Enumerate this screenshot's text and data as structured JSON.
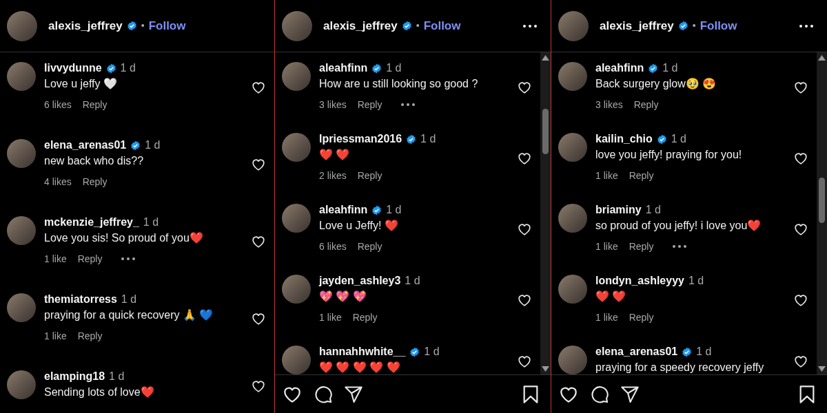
{
  "panels": [
    {
      "header": {
        "username": "alexis_jeffrey",
        "verified": true,
        "separator": "•",
        "follow": "Follow",
        "menu": false
      },
      "scrollbar": false,
      "action_bar": false,
      "comments": [
        {
          "username": "livvydunne",
          "verified": true,
          "time": "1 d",
          "text": "Love u jeffy 🤍",
          "likes": "6 likes",
          "reply": "Reply",
          "options": false,
          "liked": false
        },
        {
          "username": "elena_arenas01",
          "verified": true,
          "time": "1 d",
          "text": "new back who dis??",
          "likes": "4 likes",
          "reply": "Reply",
          "options": false,
          "liked": false
        },
        {
          "username": "mckenzie_jeffrey_",
          "verified": false,
          "time": "1 d",
          "text": "Love you sis! So proud of you❤️",
          "likes": "1 like",
          "reply": "Reply",
          "options": true,
          "liked": false
        },
        {
          "username": "themiatorress",
          "verified": false,
          "time": "1 d",
          "text": "praying for a quick recovery 🙏 💙",
          "likes": "1 like",
          "reply": "Reply",
          "options": false,
          "liked": false
        },
        {
          "username": "elamping18",
          "verified": false,
          "time": "1 d",
          "text": "Sending lots of love❤️",
          "options": false,
          "liked": false
        }
      ]
    },
    {
      "header": {
        "username": "alexis_jeffrey",
        "verified": true,
        "separator": "•",
        "follow": "Follow",
        "menu": true
      },
      "scrollbar": true,
      "action_bar": true,
      "comments": [
        {
          "username": "aleahfinn",
          "verified": true,
          "time": "1 d",
          "text": "How are u still looking so good ?",
          "likes": "3 likes",
          "reply": "Reply",
          "options": true,
          "liked": false
        },
        {
          "username": "lpriessman2016",
          "verified": true,
          "time": "1 d",
          "text": "❤️ ❤️",
          "likes": "2 likes",
          "reply": "Reply",
          "options": false,
          "liked": false
        },
        {
          "username": "aleahfinn",
          "verified": true,
          "time": "1 d",
          "text": "Love u Jeffy! ❤️",
          "likes": "6 likes",
          "reply": "Reply",
          "options": false,
          "liked": false
        },
        {
          "username": "jayden_ashley3",
          "verified": false,
          "time": "1 d",
          "text": "💖 💖 💖",
          "likes": "1 like",
          "reply": "Reply",
          "options": false,
          "liked": false
        },
        {
          "username": "hannahhwhite__",
          "verified": true,
          "time": "1 d",
          "text": "❤️ ❤️ ❤️ ❤️ ❤️",
          "options": false,
          "liked": false
        }
      ]
    },
    {
      "header": {
        "username": "alexis_jeffrey",
        "verified": true,
        "separator": "•",
        "follow": "Follow",
        "menu": true
      },
      "scrollbar": true,
      "action_bar": true,
      "comments": [
        {
          "username": "aleahfinn",
          "verified": true,
          "time": "1 d",
          "text": "Back surgery glow🥹 😍",
          "likes": "3 likes",
          "reply": "Reply",
          "options": false,
          "liked": false
        },
        {
          "username": "kailin_chio",
          "verified": true,
          "time": "1 d",
          "text": "love you jeffy! praying for you!",
          "likes": "1 like",
          "reply": "Reply",
          "options": false,
          "liked": false
        },
        {
          "username": "briaminy",
          "verified": false,
          "time": "1 d",
          "text": "so proud of you jeffy! i love you❤️",
          "likes": "1 like",
          "reply": "Reply",
          "options": true,
          "liked": false
        },
        {
          "username": "londyn_ashleyyy",
          "verified": false,
          "time": "1 d",
          "text": "❤️ ❤️",
          "likes": "1 like",
          "reply": "Reply",
          "options": false,
          "liked": false
        },
        {
          "username": "elena_arenas01",
          "verified": true,
          "time": "1 d",
          "text": "praying for a speedy recovery jeffy",
          "options": false,
          "liked": false
        }
      ]
    }
  ]
}
